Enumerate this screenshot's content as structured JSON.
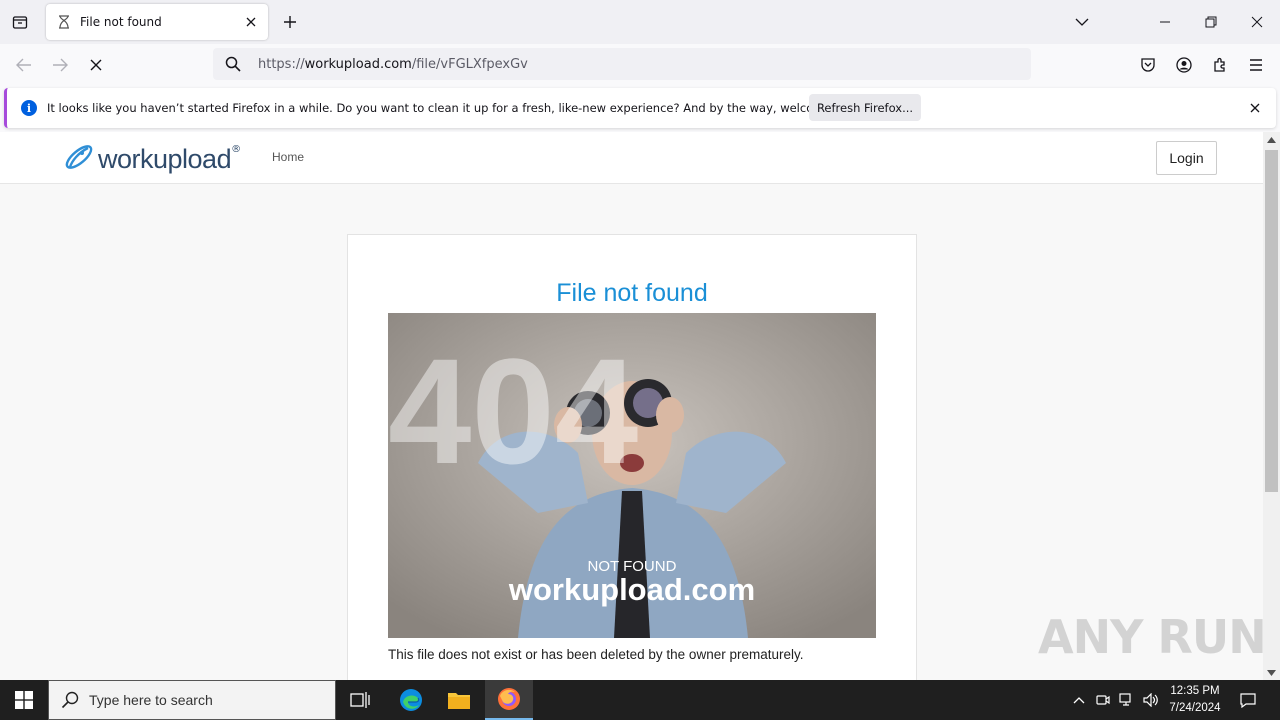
{
  "browser": {
    "tab": {
      "title": "File not found"
    },
    "url": {
      "prefix": "https://",
      "host": "workupload.com",
      "path": "/file/vFGLXfpexGv"
    },
    "notification": {
      "message": "It looks like you haven’t started Firefox in a while. Do you want to clean it up for a fresh, like-new experience? And by the way, welcome back!",
      "button_label": "Refresh Firefox..."
    }
  },
  "site": {
    "logo_text": "workupload",
    "logo_reg": "®",
    "nav": {
      "home": "Home"
    },
    "login_label": "Login"
  },
  "card": {
    "title": "File not found",
    "image_big_text": "404",
    "image_caption_small": "NOT FOUND",
    "image_caption_large": "workupload.com",
    "description": "This file does not exist or has been deleted by the owner prematurely."
  },
  "watermark": "ANY RUN",
  "taskbar": {
    "search_placeholder": "Type here to search",
    "time": "12:35 PM",
    "date": "7/24/2024"
  },
  "colors": {
    "accent_blue": "#1a8fd6",
    "logo_navy": "#2f4a6a",
    "firefox_blue": "#0060df"
  }
}
